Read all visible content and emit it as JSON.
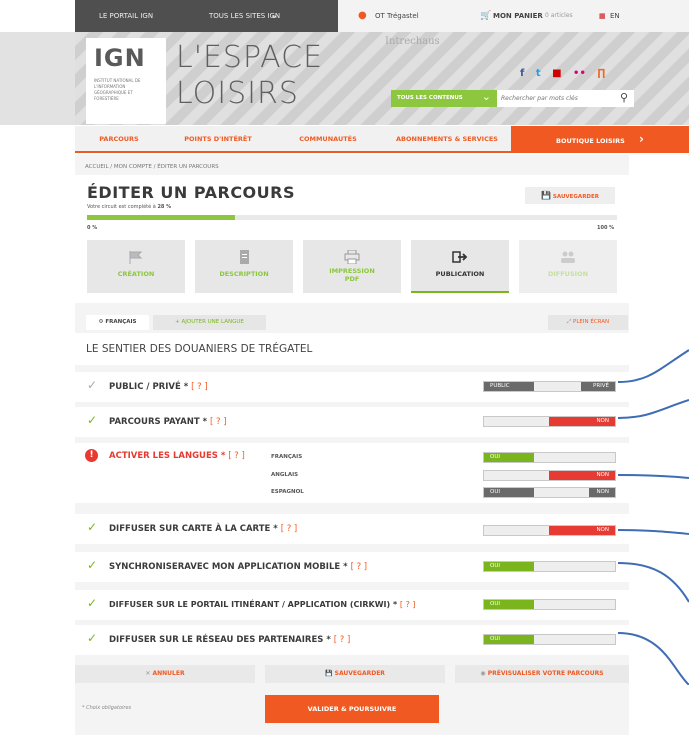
{
  "topbar": {
    "portal": "LE PORTAIL IGN",
    "all_sites": "TOUS LES SITES IGN",
    "user": "OT Trégastel",
    "cart": "MON PANIER",
    "cart_count": "0 articles",
    "lang": "EN"
  },
  "header": {
    "logo_text": "IGN",
    "logo_sub": "INSTITUT NATIONAL DE L'INFORMATION GÉOGRAPHIQUE ET FORESTIÈRE",
    "title_line1": "L'ESPACE",
    "title_line2": "LOISIRS",
    "contents_btn": "TOUS LES CONTENUS",
    "search_placeholder": "Rechercher par mots clés",
    "map_label": "Intrechaus"
  },
  "nav": {
    "items": [
      "PARCOURS",
      "POINTS D'INTÉRÊT",
      "COMMUNAUTÉS",
      "ABONNEMENTS & SERVICES",
      "BOUTIQUE LOISIRS"
    ]
  },
  "breadcrumb": "ACCUEIL / MON COMPTE / ÉDITER UN PARCOURS",
  "page": {
    "title": "ÉDITER UN PARCOURS",
    "completion_prefix": "Votre circuit est complété à",
    "completion_value": "28 %",
    "progress_min": "0 %",
    "progress_max": "100 %",
    "progress_fraction": 0.28,
    "save_top": "SAUVEGARDER"
  },
  "steps": [
    {
      "label": "CRÉATION",
      "icon": "flag-icon"
    },
    {
      "label": "DESCRIPTION",
      "icon": "document-icon"
    },
    {
      "label": "IMPRESSION PDF",
      "icon": "print-icon"
    },
    {
      "label": "PUBLICATION",
      "icon": "publish-icon"
    },
    {
      "label": "DIFFUSION",
      "icon": "users-icon"
    }
  ],
  "lang_tabs": {
    "current": "FRANÇAIS",
    "add": "AJOUTER UNE LANGUE",
    "fullscreen": "PLEIN ÉCRAN"
  },
  "route_title": "LE SENTIER DES DOUANIERS DE TRÉGATEL",
  "help": "[ ? ]",
  "settings": {
    "public_private": {
      "label": "PUBLIC / PRIVÉ *",
      "left": "PUBLIC",
      "right": "PRIVÉ"
    },
    "paid": {
      "label": "PARCOURS PAYANT *",
      "value": "NON"
    },
    "languages": {
      "label": "ACTIVER LES LANGUES *",
      "items": [
        {
          "name": "FRANÇAIS",
          "value": "OUI"
        },
        {
          "name": "ANGLAIS",
          "value": "NON"
        },
        {
          "name": "ESPAGNOL",
          "left": "OUI",
          "right": "NON"
        }
      ]
    },
    "carte": {
      "label": "DIFFUSER SUR CARTE À LA CARTE *",
      "value": "NON"
    },
    "sync": {
      "label": "SYNCHRONISERAVEC MON APPLICATION MOBILE *",
      "value": "OUI"
    },
    "cirkwi": {
      "label": "DIFFUSER SUR LE PORTAIL ITINÉRANT / APPLICATION (CIRKWI) *",
      "value": "OUI"
    },
    "partners": {
      "label": "DIFFUSER SUR LE RÉSEAU DES PARTENAIRES *",
      "value": "OUI"
    }
  },
  "actions": {
    "cancel": "ANNULER",
    "save": "SAUVEGARDER",
    "preview": "PRÉVISUALISER VOTRE PARCOURS",
    "required_note": "* Choix obligatoires",
    "validate": "VALIDER & POURSUIVRE"
  },
  "colors": {
    "accent": "#f05a22",
    "green": "#7ab51d",
    "red": "#e63a32",
    "dark": "#4f4f4f"
  }
}
